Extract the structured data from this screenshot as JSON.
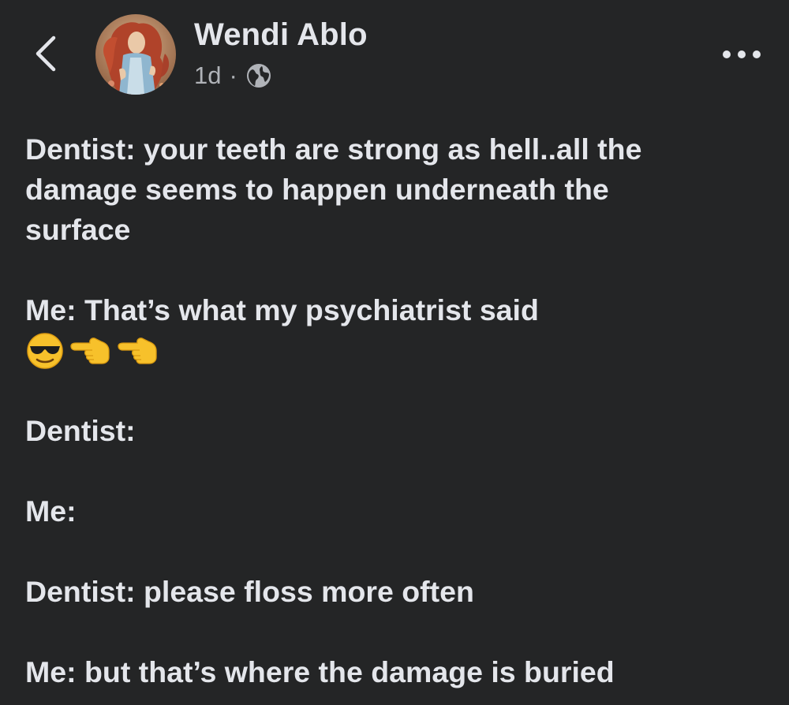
{
  "post": {
    "author": "Wendi Ablo",
    "time": "1d",
    "separator": "·",
    "privacy_icon": "globe-icon",
    "lines": [
      "Dentist: your teeth are strong as hell..all the",
      "damage seems to happen underneath the",
      "surface",
      "Me: That’s what my psychiatrist said",
      "Dentist:",
      "Me:",
      "Dentist: please floss more often",
      "Me: but that’s where the damage is buried"
    ],
    "emojis": [
      "sunglasses-face-icon",
      "pointing-left-hand-icon",
      "pointing-left-hand-icon"
    ]
  },
  "header": {
    "back_icon": "chevron-left-icon",
    "more_icon": "more-dots-icon"
  },
  "colors": {
    "background": "#242526",
    "primary_text": "#e4e6eb",
    "secondary_text": "#b0b3b8"
  }
}
